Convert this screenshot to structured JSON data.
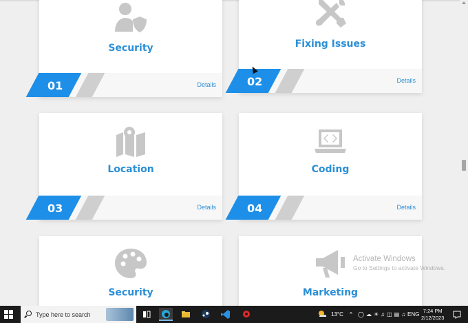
{
  "services": [
    {
      "number": "01",
      "title": "Security",
      "details": "Details",
      "icon": "user-shield-icon"
    },
    {
      "number": "02",
      "title": "Fixing Issues",
      "details": "Details",
      "icon": "tools-icon"
    },
    {
      "number": "03",
      "title": "Location",
      "details": "Details",
      "icon": "map-marker-icon"
    },
    {
      "number": "04",
      "title": "Coding",
      "details": "Details",
      "icon": "laptop-code-icon"
    },
    {
      "number": "",
      "title": "Security",
      "details": "",
      "icon": "palette-icon"
    },
    {
      "number": "",
      "title": "Marketing",
      "details": "",
      "icon": "megaphone-icon"
    }
  ],
  "watermark": {
    "line1": "Activate Windows",
    "line2": "Go to Settings to activate Windows."
  },
  "taskbar": {
    "search_placeholder": "Type here to search",
    "weather": "13°C",
    "language": "ENG",
    "time": "7:24 PM",
    "date": "2/12/2023"
  },
  "colors": {
    "accent": "#1e8fe8",
    "title": "#2b8fd6",
    "icon": "#c7c7c7"
  }
}
